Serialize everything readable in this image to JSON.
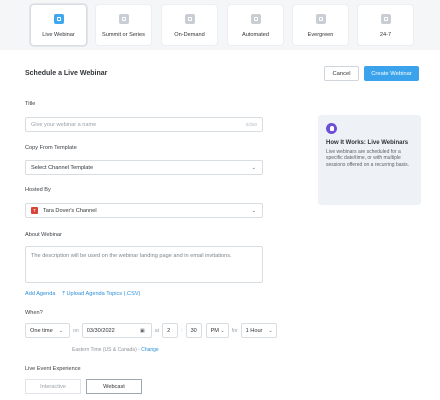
{
  "event_types": [
    {
      "label": "Live Webinar",
      "icon": "live-icon",
      "active": true
    },
    {
      "label": "Summit or Series",
      "icon": "summit-icon",
      "active": false
    },
    {
      "label": "On-Demand",
      "icon": "on-demand-icon",
      "active": false
    },
    {
      "label": "Automated",
      "icon": "automated-icon",
      "active": false
    },
    {
      "label": "Evergreen",
      "icon": "evergreen-icon",
      "active": false
    },
    {
      "label": "24-7",
      "icon": "clock-icon",
      "active": false
    }
  ],
  "header": {
    "title": "Schedule a Live Webinar",
    "cancel_label": "Cancel",
    "create_label": "Create Webinar"
  },
  "form": {
    "title_label": "Title",
    "title_placeholder": "Give your webinar a name",
    "title_counter": "0/250",
    "copy_label": "Copy From Template",
    "copy_value": "Select Channel Template",
    "hosted_label": "Hosted By",
    "hosted_avatar": "T",
    "hosted_value": "Tara Dover's Channel",
    "about_label": "About Webinar",
    "about_placeholder": "The description will be used on the webinar landing page and in email invitations.",
    "add_agenda": "Add Agenda",
    "upload_agenda": "Upload Agenda Topics (.CSV)",
    "when_label": "When?",
    "when": {
      "recurrence": "One time",
      "on": "on",
      "date": "03/30/2022",
      "at": "at",
      "hour": "2",
      "minute": "30",
      "ampm": "PM",
      "for": "for",
      "duration": "1 Hour"
    },
    "timezone": "Eastern Time (US & Canada) -",
    "timezone_change": "Change",
    "experience_label": "Live Event Experience",
    "experience_options": [
      {
        "label": "Interactive",
        "active": false
      },
      {
        "label": "Webcast",
        "active": true
      }
    ]
  },
  "info_card": {
    "title": "How It Works: Live Webinars",
    "text": "Live webinars are scheduled for a specific date/time, or with multiple sessions offered on a recurring basis."
  },
  "colors": {
    "accent": "#3aa3ec",
    "link": "#2b8fd8",
    "info_icon": "#6d4fd6"
  }
}
